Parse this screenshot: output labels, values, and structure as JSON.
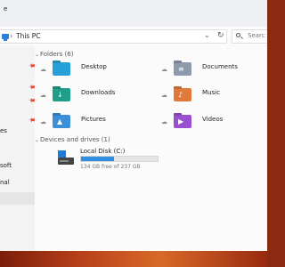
{
  "window": {
    "title_partial": "e"
  },
  "address": {
    "path_sep": "›",
    "path": "This PC",
    "refresh_glyph": "↻"
  },
  "search": {
    "placeholder": "Searc"
  },
  "nav": {
    "pins": [
      "📌",
      "📌",
      "📌",
      "📌"
    ],
    "labels": [
      "es",
      "soft",
      "nal"
    ]
  },
  "folders": {
    "header": "Folders (6)",
    "items": [
      {
        "name": "Desktop",
        "color": "#27a0d8",
        "glyph": ""
      },
      {
        "name": "Documents",
        "color": "#8c9aab",
        "glyph": "≡"
      },
      {
        "name": "Downloads",
        "color": "#1f9e8a",
        "glyph": "↓"
      },
      {
        "name": "Music",
        "color": "#e07a3a",
        "glyph": "♪"
      },
      {
        "name": "Pictures",
        "color": "#3a8fd8",
        "glyph": "▲"
      },
      {
        "name": "Videos",
        "color": "#9a4fd0",
        "glyph": "▶"
      }
    ]
  },
  "drives": {
    "header": "Devices and drives (1)",
    "items": [
      {
        "name": "Local Disk (C:)",
        "free_text": "134 GB free of 237 GB",
        "used_fraction": 0.435,
        "fill_color": "#2f8ee0"
      }
    ]
  }
}
